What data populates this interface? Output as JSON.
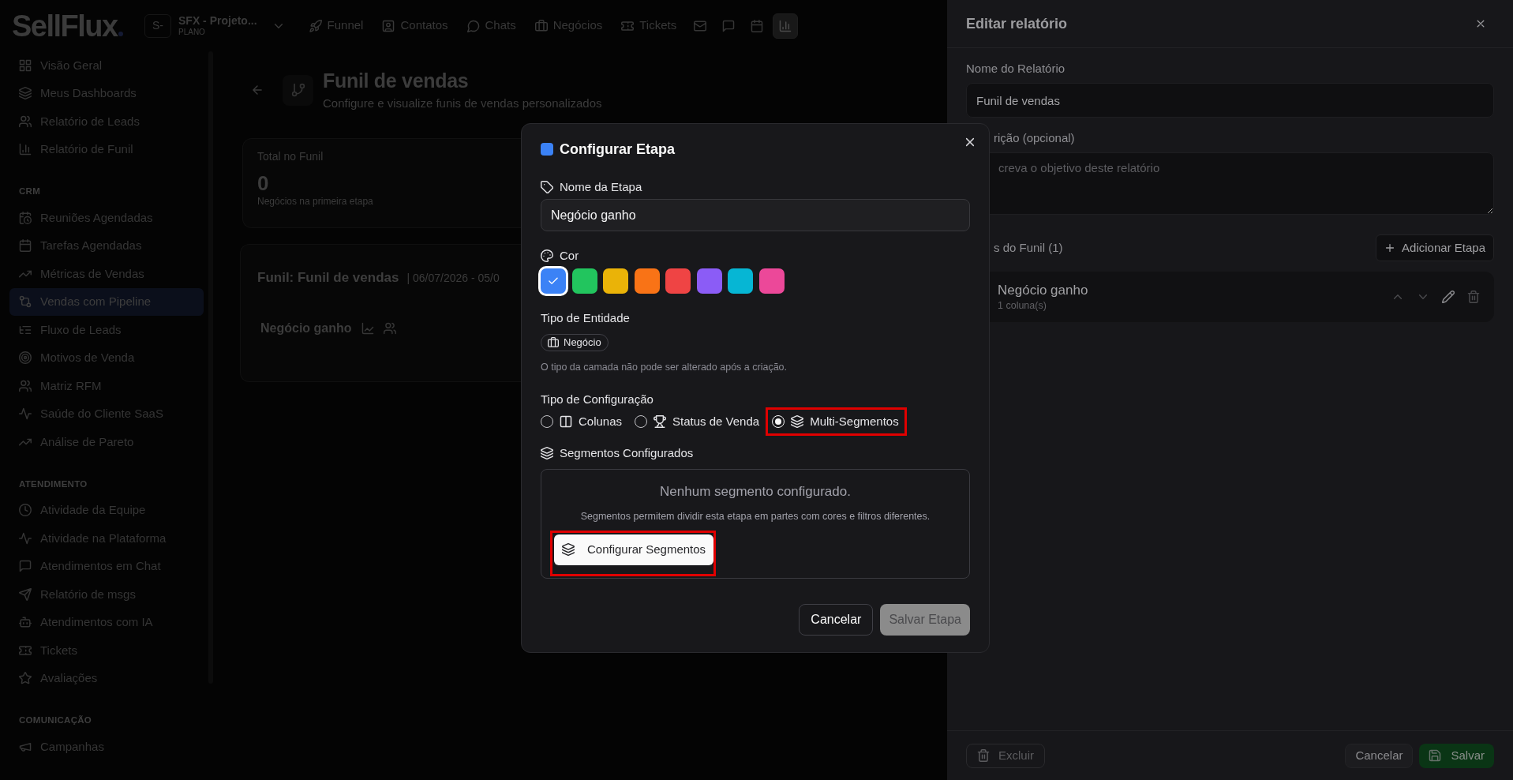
{
  "top_bar": {
    "logo": "SellFlux",
    "workspace": {
      "avatar": "S-",
      "name": "SFX - Projeto...",
      "plan": "PLANO"
    },
    "nav": [
      {
        "label": "Funnel",
        "selected": false
      },
      {
        "label": "Contatos",
        "selected": false
      },
      {
        "label": "Chats",
        "selected": false
      },
      {
        "label": "Negócios",
        "selected": false
      },
      {
        "label": "Tickets",
        "selected": false
      },
      {
        "selected": false
      },
      {
        "selected": false
      },
      {
        "selected": false
      },
      {
        "selected": true
      }
    ]
  },
  "sidebar": {
    "sections": [
      {
        "items": [
          {
            "label": "Visão Geral",
            "selected": false
          },
          {
            "label": "Meus Dashboards",
            "selected": false
          },
          {
            "label": "Relatório de Leads",
            "selected": false
          },
          {
            "label": "Relatório de Funil",
            "selected": false
          }
        ]
      },
      {
        "heading": "CRM",
        "items": [
          {
            "label": "Reuniões Agendadas",
            "selected": false
          },
          {
            "label": "Tarefas Agendadas",
            "selected": false
          },
          {
            "label": "Métricas de Vendas",
            "selected": false
          },
          {
            "label": "Vendas com Pipeline",
            "selected": true
          },
          {
            "label": "Fluxo de Leads",
            "selected": false
          },
          {
            "label": "Motivos de Venda",
            "selected": false
          },
          {
            "label": "Matriz RFM",
            "selected": false
          },
          {
            "label": "Saúde do Cliente SaaS",
            "selected": false
          },
          {
            "label": "Análise de Pareto",
            "selected": false
          }
        ]
      },
      {
        "heading": "ATENDIMENTO",
        "items": [
          {
            "label": "Atividade da Equipe",
            "selected": false
          },
          {
            "label": "Atividade na Plataforma",
            "selected": false
          },
          {
            "label": "Atendimentos em Chat",
            "selected": false
          },
          {
            "label": "Relatório de msgs",
            "selected": false
          },
          {
            "label": "Atendimentos com IA",
            "selected": false
          },
          {
            "label": "Tickets",
            "selected": false
          },
          {
            "label": "Avaliações",
            "selected": false
          }
        ]
      },
      {
        "heading": "COMUNICAÇÃO",
        "items": [
          {
            "label": "Campanhas",
            "selected": false
          }
        ]
      }
    ]
  },
  "page_header": {
    "title": "Funil de vendas",
    "subtitle": "Configure e visualize funis de vendas personalizados"
  },
  "summary_card": {
    "label": "Total no Funil",
    "value": "0",
    "caption": "Negócios na primeira etapa"
  },
  "funnel_card": {
    "title": "Funil: Funil de vendas",
    "date_range": "| 06/07/2026 - 05/0",
    "stages": [
      {
        "name": "Negócio ganho"
      }
    ]
  },
  "report_panel": {
    "title": "Editar relatório",
    "fields": [
      {
        "kind": "input",
        "label": "Nome do Relatório",
        "value": "Funil de vendas"
      },
      {
        "kind": "textarea",
        "label": "rição (opcional)",
        "placeholder": "creva o objetivo deste relatório"
      }
    ],
    "stages_heading": "s do Funil (1)",
    "add_button": "Adicionar Etapa",
    "stages": [
      {
        "name": "Negócio ganho",
        "caption": "1 coluna(s)"
      }
    ],
    "buttons": [
      {
        "kind": "delete",
        "label": "Excluir"
      },
      {
        "kind": "cancel",
        "label": "Cancelar"
      },
      {
        "kind": "save",
        "label": "Salvar"
      }
    ]
  },
  "stage_dialog": {
    "title": "Configurar Etapa",
    "name_field": {
      "label": "Nome da Etapa",
      "value": "Negócio ganho"
    },
    "color_field": {
      "label": "Cor",
      "swatches": [
        {
          "color": "#3b82f6",
          "selected": true
        },
        {
          "color": "#22c55e",
          "selected": false
        },
        {
          "color": "#eab308",
          "selected": false
        },
        {
          "color": "#f97316",
          "selected": false
        },
        {
          "color": "#ef4444",
          "selected": false
        },
        {
          "color": "#8b5cf6",
          "selected": false
        },
        {
          "color": "#06b6d4",
          "selected": false
        },
        {
          "color": "#ec4899",
          "selected": false
        }
      ]
    },
    "entity_field": {
      "label": "Tipo de Entidade",
      "badge": "Negócio",
      "note": "O tipo da camada não pode ser alterado após a criação."
    },
    "config_field": {
      "label": "Tipo de Configuração",
      "options": [
        {
          "label": "Colunas",
          "selected": false,
          "highlighted": false
        },
        {
          "label": "Status de Venda",
          "selected": false,
          "highlighted": false
        },
        {
          "label": "Multi-Segmentos",
          "selected": true,
          "highlighted": true
        }
      ]
    },
    "segments": {
      "label": "Segmentos Configurados",
      "empty_title": "Nenhum segmento configurado.",
      "empty_text": "Segmentos permitem dividir esta etapa em partes com cores e filtros diferentes.",
      "button": {
        "label": "Configurar Segmentos",
        "highlighted": true
      }
    },
    "buttons": [
      {
        "kind": "secondary",
        "label": "Cancelar",
        "disabled": false
      },
      {
        "kind": "primary",
        "label": "Salvar Etapa",
        "disabled": true
      }
    ]
  }
}
